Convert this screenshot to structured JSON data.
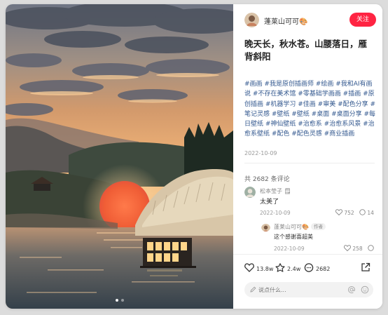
{
  "author": {
    "name": "蓬莱山可可🎨",
    "follow_label": "关注"
  },
  "post": {
    "title": "晚天长，秋水苍。山腰落日，雁背斜阳",
    "tags": "#画画 #我是原创插画师 #绘画 #我和AI有画说 #不存在美术馆 #零基础学画画 #插画 #原创插画 #机器学习 #佳画 #审美 #配色分享 #笔记灵感 #壁纸 #壁纸 #桌面 #桌面分享 #每日壁纸 #神仙壁纸 #治愈系 #治愈系风景 #治愈系壁纸 #配色 #配色灵感 #商业插画",
    "date": "2022-10-09"
  },
  "comments_header": "共 2682 条评论",
  "comments": [
    {
      "name": "松本莹子 🗒",
      "text": "太美了",
      "date": "2022-10-09",
      "likes": "752",
      "replies": "14"
    },
    {
      "name": "蓬莱山可可🎨",
      "badge": "作者",
      "text": "这个感谢喜超美",
      "date": "2022-10-09",
      "likes": "258"
    }
  ],
  "stats": {
    "likes": "13.8w",
    "collects": "2.4w",
    "comments": "2682"
  },
  "input": {
    "placeholder": "说点什么..."
  },
  "colors": {
    "accent": "#ff2442",
    "tag": "#33588f"
  }
}
